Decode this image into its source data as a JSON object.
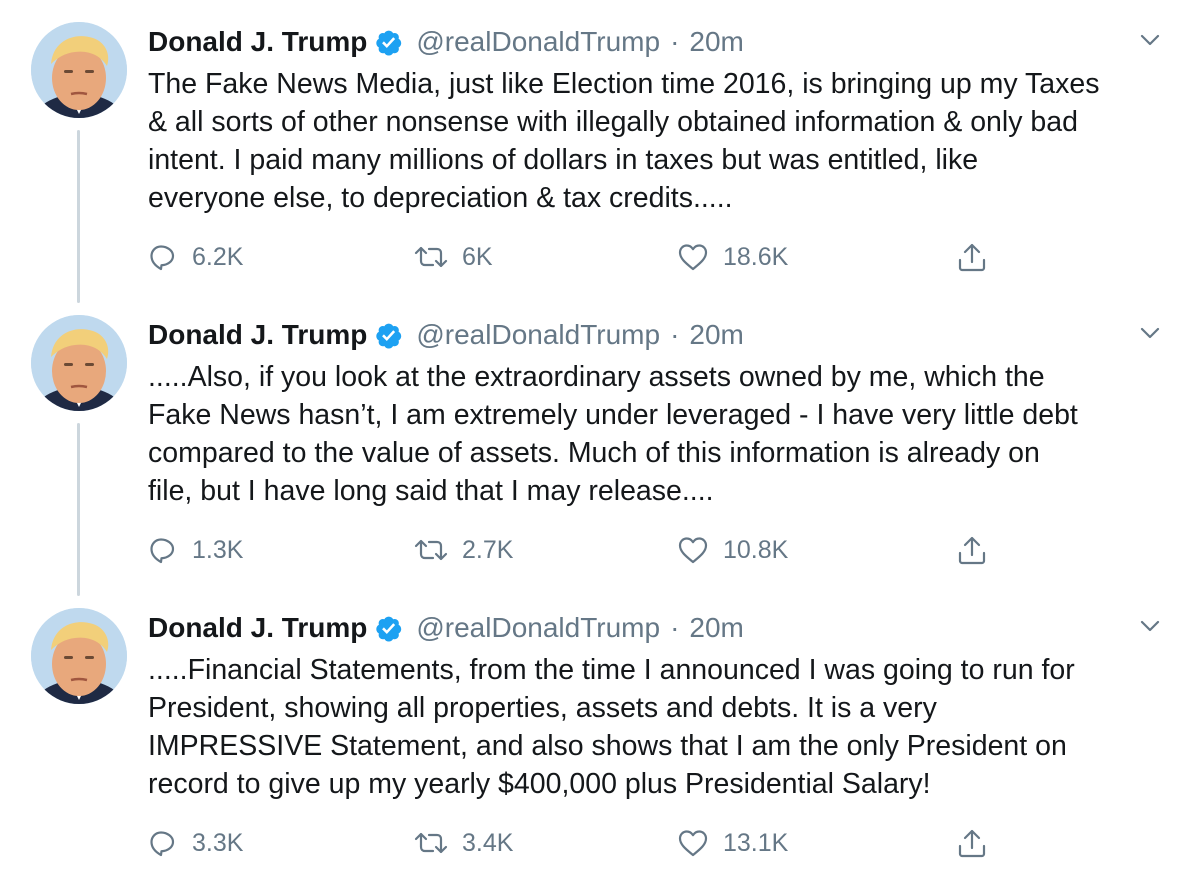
{
  "tweets": [
    {
      "author_name": "Donald J. Trump",
      "handle": "@realDonaldTrump",
      "separator": "·",
      "time": "20m",
      "text_lines": [
        "The Fake News Media, just like Election time 2016, is bringing up my Taxes",
        "& all sorts of other nonsense with illegally obtained information & only bad",
        "intent. I paid many millions of dollars in taxes but was entitled, like",
        "everyone else, to depreciation & tax credits....."
      ],
      "replies": "6.2K",
      "retweets": "6K",
      "likes": "18.6K"
    },
    {
      "author_name": "Donald J. Trump",
      "handle": "@realDonaldTrump",
      "separator": "·",
      "time": "20m",
      "text_lines": [
        ".....Also, if you look at the extraordinary assets owned by me, which the",
        "Fake News hasn’t, I am extremely under leveraged - I have very little debt",
        "compared to the value of assets. Much of this information is already on",
        "file, but I have long said that I may release...."
      ],
      "replies": "1.3K",
      "retweets": "2.7K",
      "likes": "10.8K"
    },
    {
      "author_name": "Donald J. Trump",
      "handle": "@realDonaldTrump",
      "separator": "·",
      "time": "20m",
      "text_lines": [
        ".....Financial Statements, from  the time I announced I was going to run for",
        "President,  showing all properties, assets and debts. It is a very",
        "IMPRESSIVE Statement, and also shows that I am the only President on",
        "record to give up my yearly $400,000 plus Presidential Salary!"
      ],
      "replies": "3.3K",
      "retweets": "3.4K",
      "likes": "13.1K"
    }
  ],
  "icons": {
    "verified": "verified-badge-icon",
    "caret": "chevron-down-icon",
    "reply": "reply-icon",
    "retweet": "retweet-icon",
    "like": "heart-icon",
    "share": "share-icon"
  },
  "colors": {
    "text_primary": "#14171a",
    "text_secondary": "#657786",
    "verified_blue": "#1da1f2",
    "thread_line": "#ccd6dd",
    "background": "#ffffff"
  }
}
